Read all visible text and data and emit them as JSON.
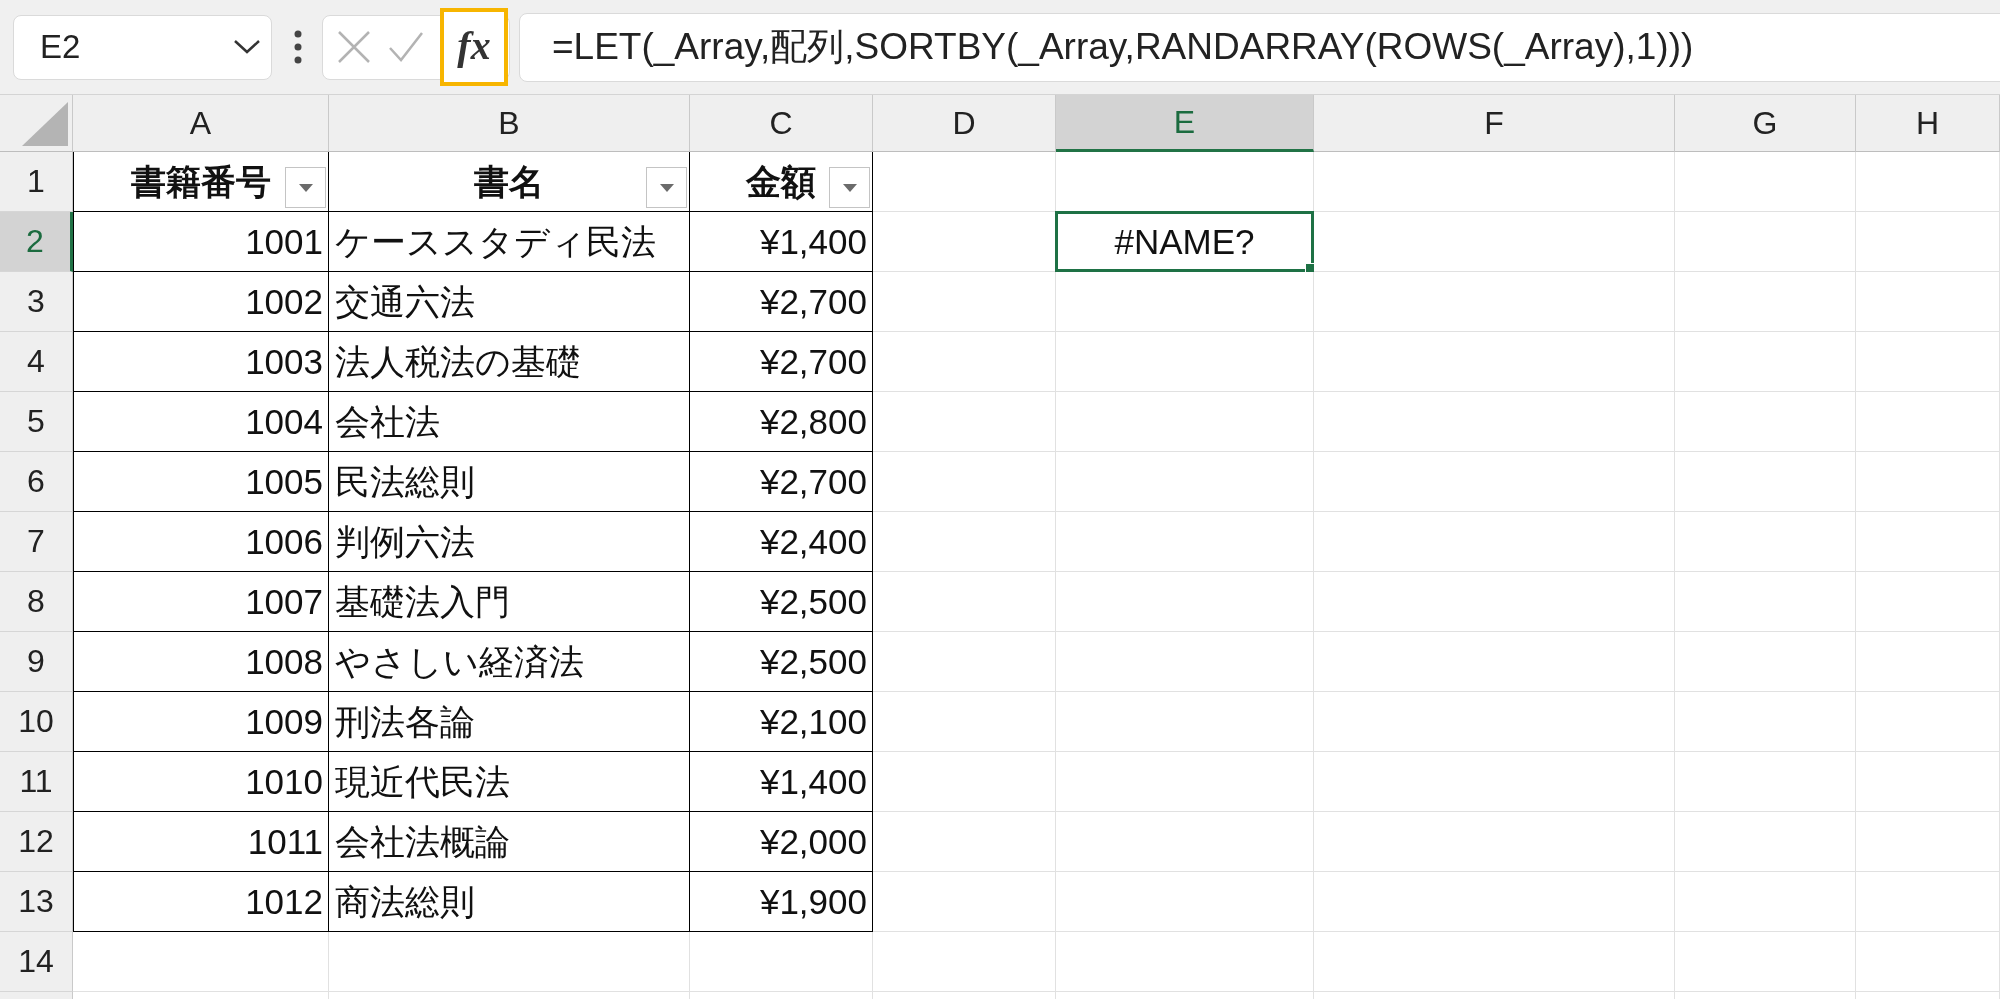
{
  "formula_bar": {
    "name_box": "E2",
    "cancel_button": {
      "disabled": true
    },
    "enter_button": {
      "disabled": true
    },
    "function_button": {
      "label": "fx",
      "highlighted": true
    },
    "formula": "=LET(_Array,配列,SORTBY(_Array,RANDARRAY(ROWS(_Array),1)))"
  },
  "sheet": {
    "columns": [
      {
        "label": "A",
        "selected": false
      },
      {
        "label": "B",
        "selected": false
      },
      {
        "label": "C",
        "selected": false
      },
      {
        "label": "D",
        "selected": false
      },
      {
        "label": "E",
        "selected": true
      },
      {
        "label": "F",
        "selected": false
      },
      {
        "label": "G",
        "selected": false
      },
      {
        "label": "H",
        "selected": false
      }
    ],
    "rows": [
      {
        "label": "1",
        "selected": false
      },
      {
        "label": "2",
        "selected": true
      },
      {
        "label": "3",
        "selected": false
      },
      {
        "label": "4",
        "selected": false
      },
      {
        "label": "5",
        "selected": false
      },
      {
        "label": "6",
        "selected": false
      },
      {
        "label": "7",
        "selected": false
      },
      {
        "label": "8",
        "selected": false
      },
      {
        "label": "9",
        "selected": false
      },
      {
        "label": "10",
        "selected": false
      },
      {
        "label": "11",
        "selected": false
      },
      {
        "label": "12",
        "selected": false
      },
      {
        "label": "13",
        "selected": false
      },
      {
        "label": "14",
        "selected": false
      }
    ],
    "table": {
      "headers": [
        {
          "label": "書籍番号",
          "filter": true
        },
        {
          "label": "書名",
          "filter": true
        },
        {
          "label": "金額",
          "filter": true
        }
      ],
      "rows": [
        [
          "1001",
          "ケーススタディ民法",
          "¥1,400"
        ],
        [
          "1002",
          "交通六法",
          "¥2,700"
        ],
        [
          "1003",
          "法人税法の基礎",
          "¥2,700"
        ],
        [
          "1004",
          "会社法",
          "¥2,800"
        ],
        [
          "1005",
          "民法総則",
          "¥2,700"
        ],
        [
          "1006",
          "判例六法",
          "¥2,400"
        ],
        [
          "1007",
          "基礎法入門",
          "¥2,500"
        ],
        [
          "1008",
          "やさしい経済法",
          "¥2,500"
        ],
        [
          "1009",
          "刑法各論",
          "¥2,100"
        ],
        [
          "1010",
          "現近代民法",
          "¥1,400"
        ],
        [
          "1011",
          "会社法概論",
          "¥2,000"
        ],
        [
          "1012",
          "商法総則",
          "¥1,900"
        ]
      ]
    },
    "active_cell": {
      "value": "#NAME?"
    }
  }
}
